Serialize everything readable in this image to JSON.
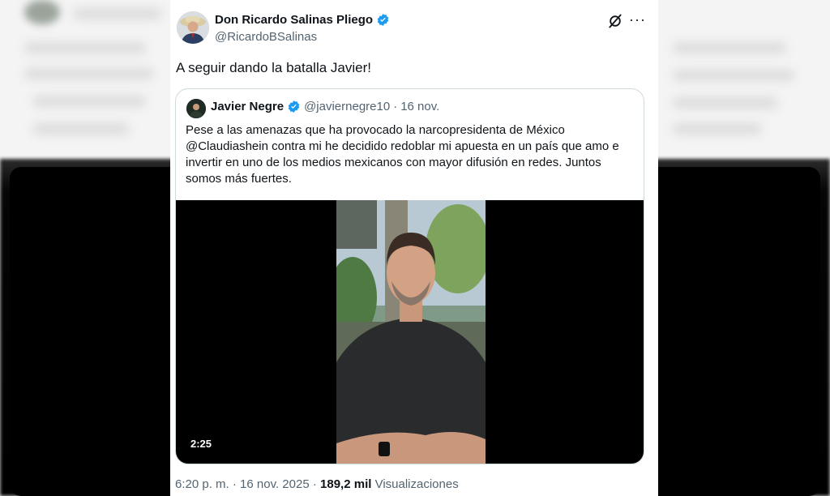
{
  "tweet": {
    "author_name": "Don Ricardo Salinas Pliego",
    "author_handle": "@RicardoBSalinas",
    "text": "A seguir dando la batalla Javier!",
    "time": "6:20 p. m.",
    "separator": "·",
    "date": "16 nov. 2025",
    "views_count": "189,2 mil",
    "views_label": "Visualizaciones"
  },
  "quoted": {
    "author_name": "Javier Negre",
    "author_handle": "@javiernegre10",
    "separator": "·",
    "date": "16 nov.",
    "text": "Pese a las amenazas que ha provocado la narcopresidenta de México @Claudiashein contra mi he decidido redoblar mi apuesta en un país que amo e invertir en uno de los medios mexicanos con mayor difusión en redes. Juntos somos más fuertes.",
    "video_duration": "2:25"
  },
  "icons": {
    "verified": "verified-badge-icon",
    "grok": "grok-icon",
    "more": "more-options-icon"
  },
  "colors": {
    "verified_blue": "#1d9bf0",
    "secondary_text": "#536471",
    "border": "#cfd9de"
  }
}
